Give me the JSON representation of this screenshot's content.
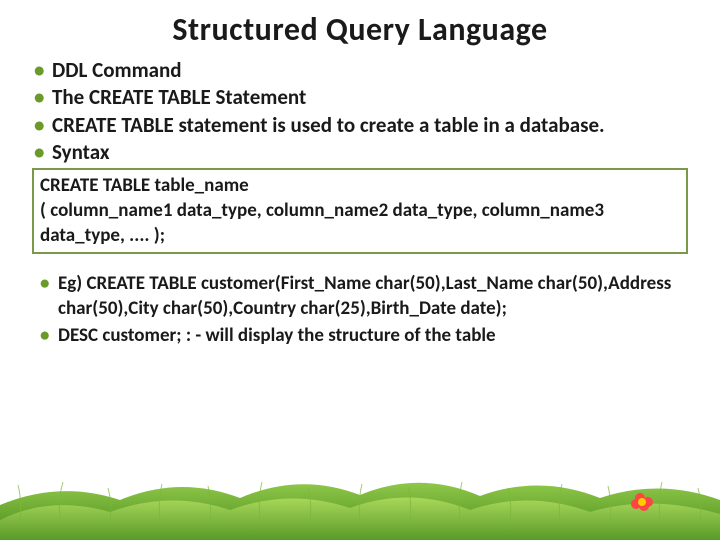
{
  "title": "Structured Query Language",
  "bullets1": [
    "DDL  Command",
    "The CREATE TABLE Statement",
    "CREATE TABLE statement is used to create a table in a database.",
    "Syntax"
  ],
  "syntax": "CREATE TABLE table_name\n( column_name1 data_type, column_name2 data_type, column_name3 data_type, .... );",
  "bullets2": [
    "Eg) CREATE TABLE customer(First_Name char(50),Last_Name char(50),Address char(50),City char(50),Country char(25),Birth_Date date);",
    "DESC customer; : - will display the structure of the table"
  ]
}
